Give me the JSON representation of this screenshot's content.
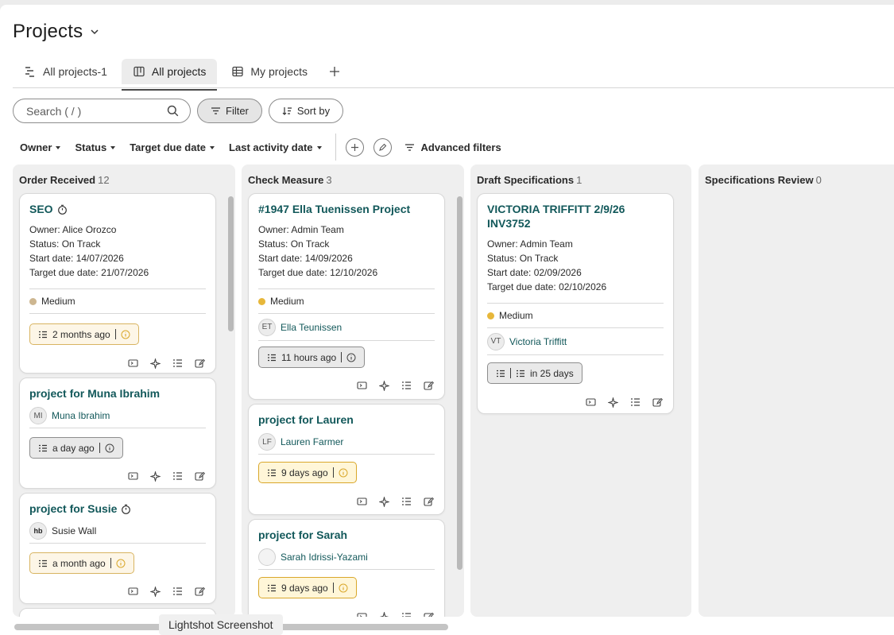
{
  "header": {
    "title": "Projects"
  },
  "tabs": [
    {
      "label": "All projects-1",
      "icon": "gantt-icon"
    },
    {
      "label": "All projects",
      "icon": "board-icon",
      "active": true
    },
    {
      "label": "My projects",
      "icon": "table-icon"
    }
  ],
  "toolbar": {
    "search_placeholder": "Search ( / )",
    "filter_label": "Filter",
    "sort_label": "Sort by"
  },
  "filters": {
    "owner": "Owner",
    "status": "Status",
    "target_due": "Target due date",
    "last_activity": "Last activity date",
    "advanced": "Advanced filters"
  },
  "columns": [
    {
      "title": "Order Received",
      "count": "12",
      "cards": [
        {
          "title": "SEO",
          "owner": "Owner: Alice Orozco",
          "status": "Status: On Track",
          "start": "Start date: 14/07/2026",
          "due": "Target due date: 21/07/2026",
          "priority": "Medium",
          "activity": "2 months ago"
        },
        {
          "title": "project for Muna Ibrahim",
          "initials": "MI",
          "person": "Muna Ibrahim",
          "activity": "a day ago"
        },
        {
          "title": "project for Susie",
          "initials": "hb",
          "person": "Susie Wall",
          "activity": "a month ago"
        }
      ]
    },
    {
      "title": "Check Measure",
      "count": "3",
      "cards": [
        {
          "title": "#1947 Ella Tuenissen Project",
          "owner": "Owner: Admin Team",
          "status": "Status: On Track",
          "start": "Start date: 14/09/2026",
          "due": "Target due date: 12/10/2026",
          "priority": "Medium",
          "initials": "ET",
          "person": "Ella Teunissen",
          "activity": "11 hours ago"
        },
        {
          "title": "project for Lauren",
          "initials": "LF",
          "person": "Lauren Farmer",
          "activity": "9 days ago"
        },
        {
          "title": "project for Sarah",
          "initials": "",
          "person": "Sarah Idrissi-Yazami",
          "activity": "9 days ago"
        }
      ]
    },
    {
      "title": "Draft Specifications",
      "count": "1",
      "cards": [
        {
          "title": "VICTORIA TRIFFITT 2/9/26 INV3752",
          "owner": "Owner: Admin Team",
          "status": "Status: On Track",
          "start": "Start date: 02/09/2026",
          "due": "Target due date: 02/10/2026",
          "priority": "Medium",
          "initials": "VT",
          "person": "Victoria Triffitt",
          "activity": "in 25 days"
        }
      ]
    },
    {
      "title": "Specifications Review",
      "count": "0",
      "cards": []
    }
  ],
  "taskbar": {
    "lightshot": "Lightshot Screenshot"
  },
  "colors": {
    "accent": "#12585a",
    "priority_tan": "#cdb690",
    "priority_amber": "#e7b73a",
    "warn_border": "#d9a72a"
  }
}
